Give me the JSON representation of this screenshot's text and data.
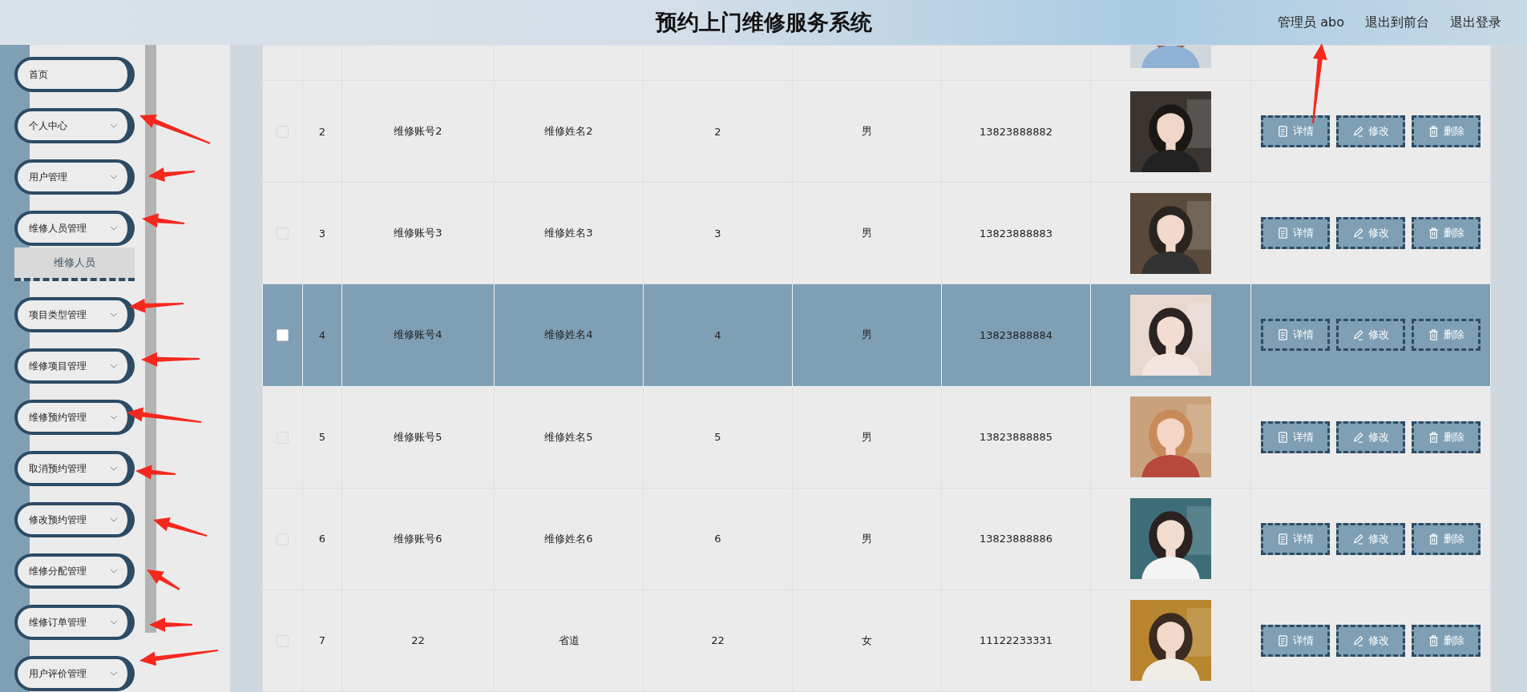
{
  "header": {
    "title": "预约上门维修服务系统",
    "user": "管理员 abo",
    "links": [
      "退出到前台",
      "退出登录"
    ]
  },
  "sidebar": {
    "items": [
      {
        "label": "首页",
        "expandable": false
      },
      {
        "label": "个人中心",
        "expandable": true
      },
      {
        "label": "用户管理",
        "expandable": true
      },
      {
        "label": "维修人员管理",
        "expandable": true,
        "children": [
          {
            "label": "维修人员"
          }
        ]
      },
      {
        "label": "项目类型管理",
        "expandable": true
      },
      {
        "label": "维修项目管理",
        "expandable": true
      },
      {
        "label": "维修预约管理",
        "expandable": true
      },
      {
        "label": "取消预约管理",
        "expandable": true
      },
      {
        "label": "修改预约管理",
        "expandable": true
      },
      {
        "label": "维修分配管理",
        "expandable": true
      },
      {
        "label": "维修订单管理",
        "expandable": true
      },
      {
        "label": "用户评价管理",
        "expandable": true
      }
    ]
  },
  "table": {
    "rows": [
      {
        "checked": false,
        "selected": false,
        "index": "2",
        "account": "维修账号2",
        "name": "维修姓名2",
        "column_4": "2",
        "gender": "男",
        "phone": "13823888882",
        "actions": [
          {
            "kind": "detail",
            "label": "详情"
          },
          {
            "kind": "edit",
            "label": "修改"
          },
          {
            "kind": "delete",
            "label": "删除"
          }
        ]
      },
      {
        "checked": false,
        "selected": false,
        "index": "3",
        "account": "维修账号3",
        "name": "维修姓名3",
        "column_4": "3",
        "gender": "男",
        "phone": "13823888883",
        "actions": [
          {
            "kind": "detail",
            "label": "详情"
          },
          {
            "kind": "edit",
            "label": "修改"
          },
          {
            "kind": "delete",
            "label": "删除"
          }
        ]
      },
      {
        "checked": false,
        "selected": true,
        "index": "4",
        "account": "维修账号4",
        "name": "维修姓名4",
        "column_4": "4",
        "gender": "男",
        "phone": "13823888884",
        "actions": [
          {
            "kind": "detail",
            "label": "详情"
          },
          {
            "kind": "edit",
            "label": "修改"
          },
          {
            "kind": "delete",
            "label": "删除"
          }
        ]
      },
      {
        "checked": false,
        "selected": false,
        "index": "5",
        "account": "维修账号5",
        "name": "维修姓名5",
        "column_4": "5",
        "gender": "男",
        "phone": "13823888885",
        "actions": [
          {
            "kind": "detail",
            "label": "详情"
          },
          {
            "kind": "edit",
            "label": "修改"
          },
          {
            "kind": "delete",
            "label": "删除"
          }
        ]
      },
      {
        "checked": false,
        "selected": false,
        "index": "6",
        "account": "维修账号6",
        "name": "维修姓名6",
        "column_4": "6",
        "gender": "男",
        "phone": "13823888886",
        "actions": [
          {
            "kind": "detail",
            "label": "详情"
          },
          {
            "kind": "edit",
            "label": "修改"
          },
          {
            "kind": "delete",
            "label": "删除"
          }
        ]
      },
      {
        "checked": false,
        "selected": false,
        "index": "7",
        "account": "22",
        "name": "省道",
        "column_4": "22",
        "gender": "女",
        "phone": "11122233331",
        "actions": [
          {
            "kind": "detail",
            "label": "详情"
          },
          {
            "kind": "edit",
            "label": "修改"
          },
          {
            "kind": "delete",
            "label": "删除"
          }
        ]
      }
    ]
  }
}
